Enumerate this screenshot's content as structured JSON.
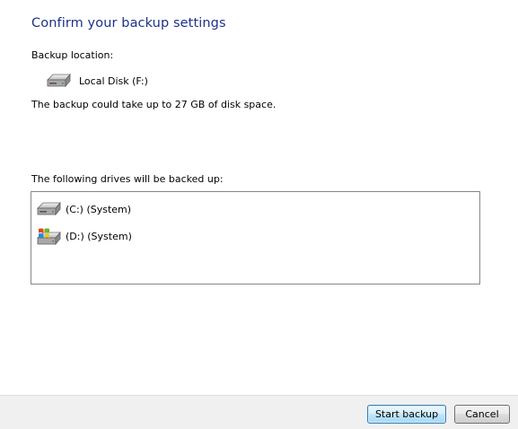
{
  "dialog": {
    "title": "Confirm your backup settings",
    "backup_location_label": "Backup location:",
    "backup_location": {
      "icon": "hard-drive-icon",
      "name": "Local Disk (F:)"
    },
    "space_note": "The backup could take up to 27 GB of disk space.",
    "drives_label": "The following drives will be backed up:",
    "drives": [
      {
        "icon": "hard-drive-icon",
        "name": "(C:) (System)"
      },
      {
        "icon": "windows-drive-icon",
        "name": "(D:) (System)"
      }
    ]
  },
  "footer": {
    "start_button": "Start backup",
    "cancel_button": "Cancel"
  },
  "colors": {
    "title": "#1e3287",
    "footer_bg": "#f0f0f0",
    "box_border": "#828790"
  }
}
